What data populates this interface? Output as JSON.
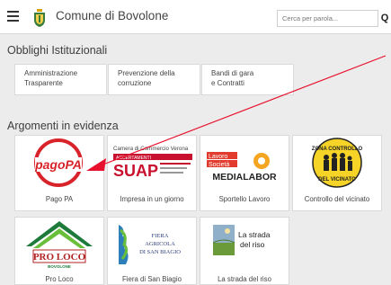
{
  "header": {
    "title": "Comune di Bovolone",
    "search_placeholder": "Cerca per parola...",
    "search_button": "Q"
  },
  "obblighi": {
    "title": "Obblighi Istituzionali",
    "items": [
      {
        "line1": "Amministrazione",
        "line2": "Trasparente"
      },
      {
        "line1": "Prevenzione della",
        "line2": "corruzione"
      },
      {
        "line1": "Bandi di gara",
        "line2": "e Contratti"
      }
    ]
  },
  "argomenti": {
    "title": "Argomenti in evidenza",
    "cards": [
      {
        "label": "Pago PA",
        "logo_text": "pagoPA"
      },
      {
        "label": "Impresa in un giorno",
        "logo_text": "SUAP",
        "banner_text": "Camera di Commercio Verona",
        "banner_sub": "ACCERTAMENTI"
      },
      {
        "label": "Sportello Lavoro",
        "logo_text": "MEDIALABOR",
        "logo_tag1": "Lavoro",
        "logo_tag2": "Società"
      },
      {
        "label": "Controllo del vicinato",
        "logo_text_top": "ZONA CONTROLLO",
        "logo_text_bottom": "DEL VICINATO"
      },
      {
        "label": "Pro Loco",
        "logo_text": "PRO LOCO",
        "logo_sub": "BOVOLONE"
      },
      {
        "label": "Fiera di San Biagio",
        "logo_line1": "FIERA",
        "logo_line2": "AGRICOLA",
        "logo_line3": "DI SAN BIAGIO"
      },
      {
        "label": "La strada del riso",
        "logo_line1": "La strada",
        "logo_line2": "del riso"
      }
    ]
  },
  "colors": {
    "background": "#ececec",
    "pagopa_red": "#d8232a",
    "suap_red": "#c8102e",
    "arrow_red": "#e8112d",
    "proloco_green": "#1d7a3a"
  }
}
